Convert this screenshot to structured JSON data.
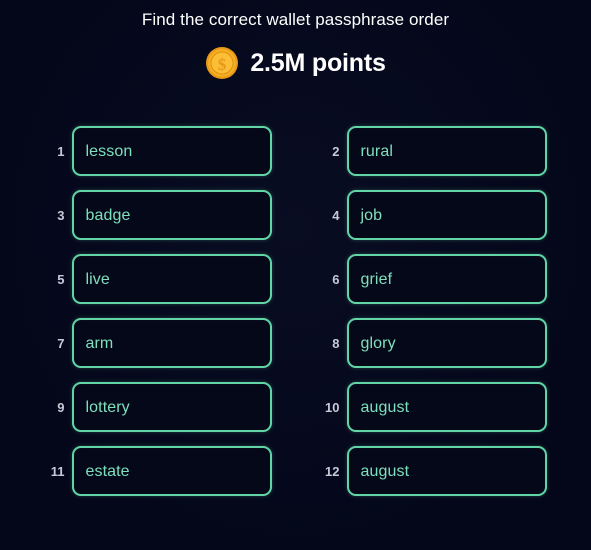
{
  "header": {
    "title": "Find the correct wallet passphrase order",
    "coin_icon": "gold-coin-dollar-icon",
    "points_label": "2.5M points"
  },
  "theme": {
    "background": "#04071a",
    "box_border": "#63d4a6",
    "word_text": "#7fe0bd",
    "number_text": "#c5cad6",
    "title_text": "#ffffff",
    "coin_outer": "#f0a81e",
    "coin_inner": "#fbbe36"
  },
  "grid": {
    "columns": 2,
    "rows": 6,
    "slots": [
      {
        "index": "1",
        "word": "lesson"
      },
      {
        "index": "2",
        "word": "rural"
      },
      {
        "index": "3",
        "word": "badge"
      },
      {
        "index": "4",
        "word": "job"
      },
      {
        "index": "5",
        "word": "live"
      },
      {
        "index": "6",
        "word": "grief"
      },
      {
        "index": "7",
        "word": "arm"
      },
      {
        "index": "8",
        "word": "glory"
      },
      {
        "index": "9",
        "word": "lottery"
      },
      {
        "index": "10",
        "word": "august"
      },
      {
        "index": "11",
        "word": "estate"
      },
      {
        "index": "12",
        "word": "august"
      }
    ]
  }
}
